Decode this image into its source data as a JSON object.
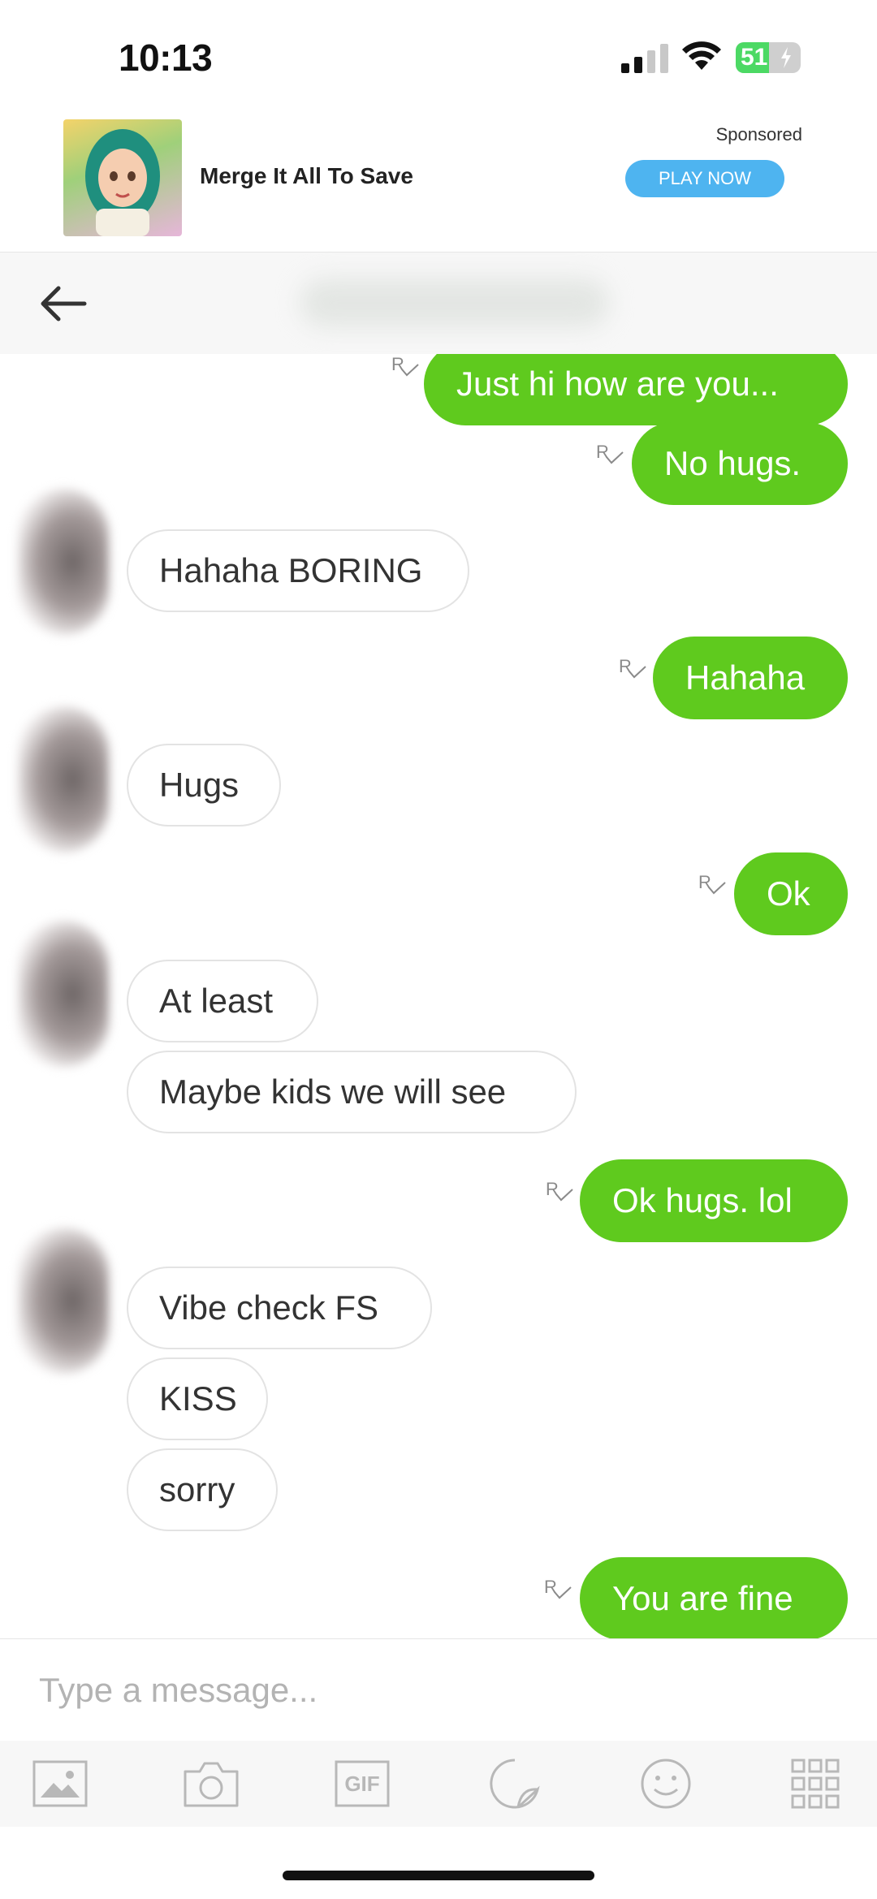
{
  "status_bar": {
    "time": "10:13",
    "battery": "51",
    "battery_level": 0.51
  },
  "ad": {
    "title": "Merge It All To Save",
    "sponsored": "Sponsored",
    "cta": "PLAY NOW"
  },
  "messages": [
    {
      "dir": "out",
      "text": "Just hi how are you...",
      "receipt": "R"
    },
    {
      "dir": "out",
      "text": "No hugs.",
      "receipt": "R"
    },
    {
      "dir": "in",
      "text": "Hahaha BORING"
    },
    {
      "dir": "out",
      "text": "Hahaha",
      "receipt": "R"
    },
    {
      "dir": "in",
      "text": "Hugs"
    },
    {
      "dir": "out",
      "text": "Ok",
      "receipt": "R"
    },
    {
      "dir": "in",
      "text": "At least"
    },
    {
      "dir": "in",
      "text": "Maybe kids we will see"
    },
    {
      "dir": "out",
      "text": "Ok hugs. lol",
      "receipt": "R"
    },
    {
      "dir": "in",
      "text": "Vibe check FS"
    },
    {
      "dir": "in",
      "text": "KISS"
    },
    {
      "dir": "in",
      "text": "sorry"
    },
    {
      "dir": "out",
      "text": "You are fine",
      "receipt": "R"
    }
  ],
  "composer": {
    "placeholder": "Type a message..."
  },
  "toolbar": {
    "items": [
      "image-icon",
      "camera-icon",
      "gif-icon",
      "sticker-icon",
      "emoji-icon",
      "grid-icon"
    ],
    "gif_label": "GIF"
  },
  "colors": {
    "outgoing_bubble": "#5fca1e",
    "ad_button": "#4eb4f0"
  }
}
